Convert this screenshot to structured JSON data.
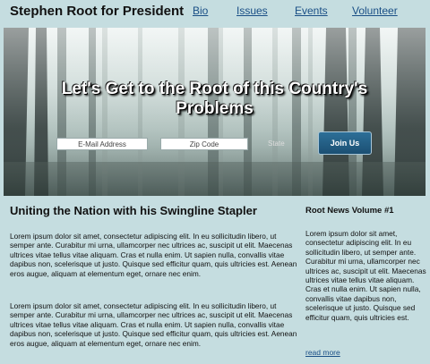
{
  "header": {
    "site_title": "Stephen Root for President",
    "nav": [
      {
        "label": "Bio"
      },
      {
        "label": "Issues"
      },
      {
        "label": "Events"
      },
      {
        "label": "Volunteer"
      }
    ]
  },
  "hero": {
    "headline": "Let's Get to the Root of this Country's Problems",
    "email_placeholder": "E-Mail Address",
    "zip_placeholder": "Zip Code",
    "state_label": "State",
    "join_label": "Join Us"
  },
  "main": {
    "heading": "Uniting the Nation with his Swingline Stapler",
    "paragraphs": [
      "Lorem ipsum dolor sit amet, consectetur adipiscing elit. In eu sollicitudin libero, ut semper ante. Curabitur mi urna, ullamcorper nec ultrices ac, suscipit ut elit. Maecenas ultrices vitae tellus vitae aliquam. Cras et nulla enim. Ut sapien nulla, convallis vitae dapibus non, scelerisque ut justo. Quisque sed efficitur quam, quis ultricies est. Aenean eros augue, aliquam at elementum eget, ornare nec enim.",
      "Lorem ipsum dolor sit amet, consectetur adipiscing elit. In eu sollicitudin libero, ut semper ante. Curabitur mi urna, ullamcorper nec ultrices ac, suscipit ut elit. Maecenas ultrices vitae tellus vitae aliquam. Cras et nulla enim. Ut sapien nulla, convallis vitae dapibus non, scelerisque ut justo. Quisque sed efficitur quam, quis ultricies est. Aenean eros augue, aliquam at elementum eget, ornare nec enim."
    ]
  },
  "sidebar": {
    "heading": "Root News Volume #1",
    "text": "Lorem ipsum dolor sit amet, consectetur adipiscing elit. In eu sollicitudin libero, ut semper ante. Curabitur mi urna, ullamcorper nec ultrices ac, suscipit ut elit. Maecenas ultrices vitae tellus vitae aliquam. Cras et nulla enim. Ut sapien nulla, convallis vitae dapibus non, scelerisque ut justo. Quisque sed efficitur quam, quis ultricies est.",
    "read_more": "read more"
  }
}
